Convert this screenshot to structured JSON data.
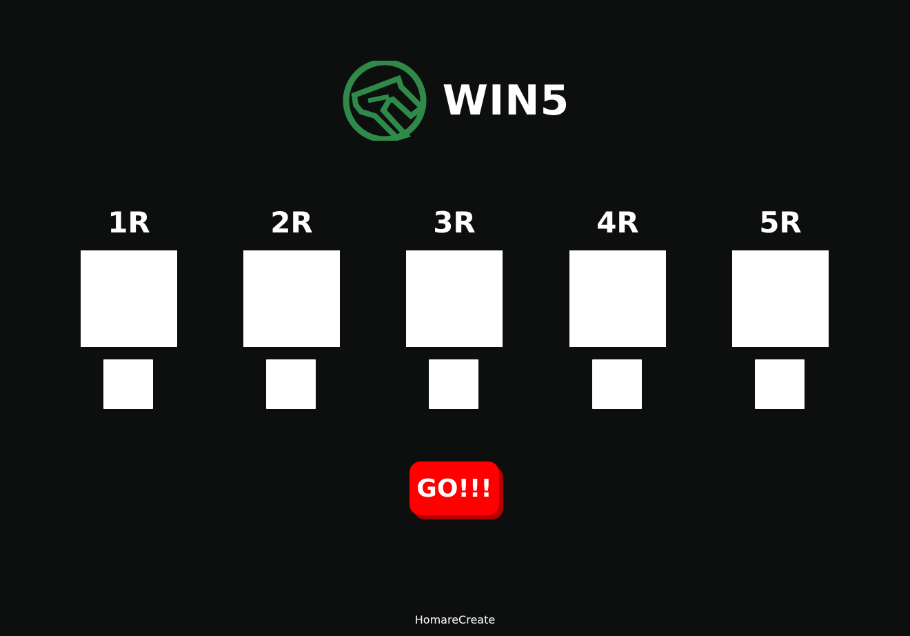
{
  "header": {
    "logo_icon": "horse-head-logo-icon",
    "title": "WIN5",
    "accent_color": "#2f8a4a"
  },
  "rounds": [
    {
      "label": "1R"
    },
    {
      "label": "2R"
    },
    {
      "label": "3R"
    },
    {
      "label": "4R"
    },
    {
      "label": "5R"
    }
  ],
  "go_button": {
    "label": "GO!!!",
    "color": "#ff0000",
    "shadow_color": "#b30000"
  },
  "footer": {
    "text": "HomareCreate"
  }
}
